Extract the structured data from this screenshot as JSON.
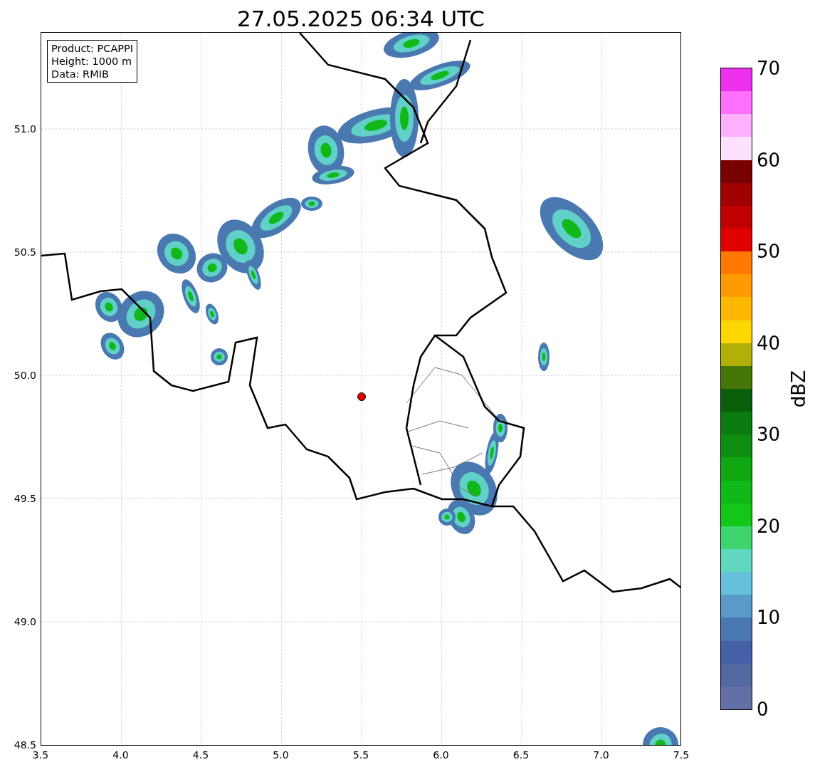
{
  "title": "27.05.2025 06:34 UTC",
  "info_box": [
    "Product: PCAPPI",
    "Height: 1000 m",
    "Data: RMIB"
  ],
  "map": {
    "x_ticks": [
      "3.5",
      "4.0",
      "4.5",
      "5.0",
      "5.5",
      "6.0",
      "6.5",
      "7.0",
      "7.5"
    ],
    "y_ticks": [
      "51.0",
      "50.5",
      "50.0",
      "49.5",
      "49.0",
      "48.5"
    ]
  },
  "colorbar": {
    "label": "dBZ",
    "ticks": [
      "70",
      "60",
      "50",
      "40",
      "30",
      "20",
      "10",
      "0"
    ],
    "bins": [
      {
        "color": "#6370a8"
      },
      {
        "color": "#5468a0"
      },
      {
        "color": "#4560a6"
      },
      {
        "color": "#4a78b0"
      },
      {
        "color": "#5a9ac8"
      },
      {
        "color": "#66c0dc"
      },
      {
        "color": "#60d8c0"
      },
      {
        "color": "#3ed46e"
      },
      {
        "color": "#12c61a"
      },
      {
        "color": "#10b818"
      },
      {
        "color": "#0fa812"
      },
      {
        "color": "#0e8e10"
      },
      {
        "color": "#0b7a10"
      },
      {
        "color": "#095e0a"
      },
      {
        "color": "#457507"
      },
      {
        "color": "#b0b008"
      },
      {
        "color": "#ffd700"
      },
      {
        "color": "#ffb800"
      },
      {
        "color": "#ff9a00"
      },
      {
        "color": "#ff7800"
      },
      {
        "color": "#e00000"
      },
      {
        "color": "#c00000"
      },
      {
        "color": "#a00000"
      },
      {
        "color": "#780000"
      },
      {
        "color": "#ffe0ff"
      },
      {
        "color": "#ffb0ff"
      },
      {
        "color": "#ff70ff"
      },
      {
        "color": "#ee30ee"
      }
    ]
  }
}
